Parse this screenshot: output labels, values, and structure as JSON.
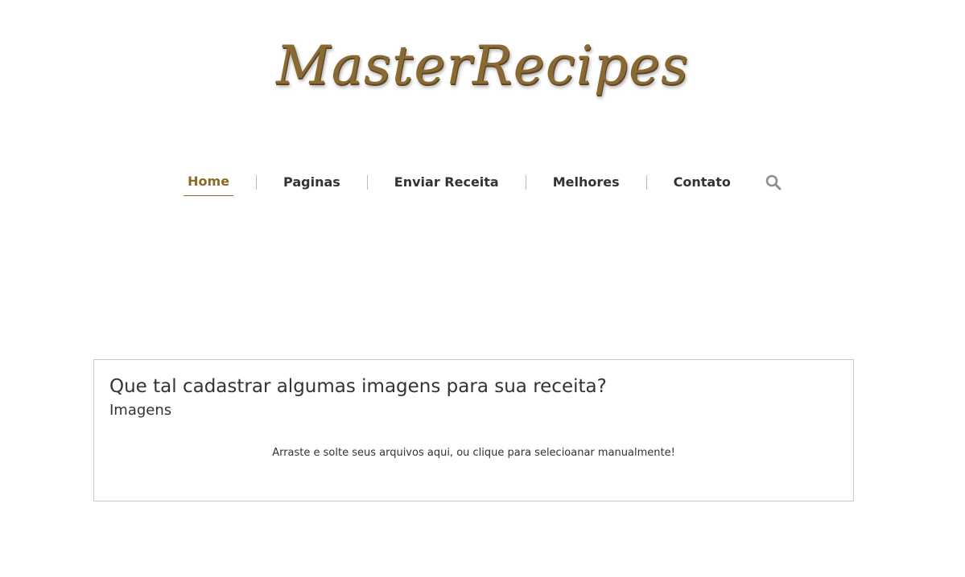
{
  "header": {
    "logo_text": "MasterRecipes"
  },
  "nav": {
    "items": [
      {
        "label": "Home",
        "active": true
      },
      {
        "label": "Paginas"
      },
      {
        "label": "Enviar Receita"
      },
      {
        "label": "Melhores"
      },
      {
        "label": "Contato"
      }
    ],
    "search_icon": "search-icon"
  },
  "upload": {
    "title": "Que tal cadastrar algumas imagens para sua receita?",
    "subtitle": "Imagens",
    "dropzone_text": "Arraste e solte seus arquivos aqui, ou clique para selecioanar manualmente!"
  },
  "colors": {
    "accent": "#8b6b25",
    "text": "#333333",
    "border": "#c7c7c7"
  }
}
